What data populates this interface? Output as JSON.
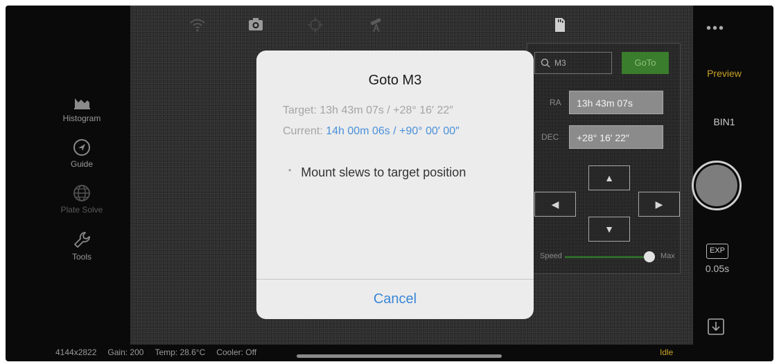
{
  "top_icons": [
    "wifi-icon",
    "camera-icon",
    "crosshair-icon",
    "telescope-icon",
    "sd-card-icon"
  ],
  "sidebar": {
    "items": [
      {
        "label": "Histogram",
        "icon": "histogram-icon"
      },
      {
        "label": "Guide",
        "icon": "guide-icon"
      },
      {
        "label": "Plate Solve",
        "icon": "globe-icon"
      },
      {
        "label": "Tools",
        "icon": "wrench-icon"
      }
    ]
  },
  "right_panel": {
    "preview_label": "Preview",
    "bin_label": "BIN1",
    "exp_label": "EXP",
    "exp_value": "0.05s",
    "more": "•••"
  },
  "mount_panel": {
    "search_value": "M3",
    "goto_label": "GoTo",
    "ra_label": "RA",
    "ra_value": "13h 43m 07s",
    "dec_label": "DEC",
    "dec_value": "+28° 16′ 22″",
    "speed_label": "Speed",
    "speed_max": "Max"
  },
  "statusbar": {
    "resolution": "4144x2822",
    "gain": "Gain: 200",
    "temp": "Temp: 28.6°C",
    "cooler": "Cooler: Off",
    "state": "Idle"
  },
  "dialog": {
    "title": "Goto M3",
    "target_label": "Target:",
    "target_value": "13h 43m 07s / +28° 16′ 22″",
    "current_label": "Current:",
    "current_value": "14h 00m 06s / +90° 00′ 00″",
    "bullet": "Mount slews to target position",
    "cancel_label": "Cancel"
  },
  "colors": {
    "accent_gold": "#c9a227",
    "link_blue": "#3a86d6",
    "goto_green": "#3a7d2c"
  }
}
